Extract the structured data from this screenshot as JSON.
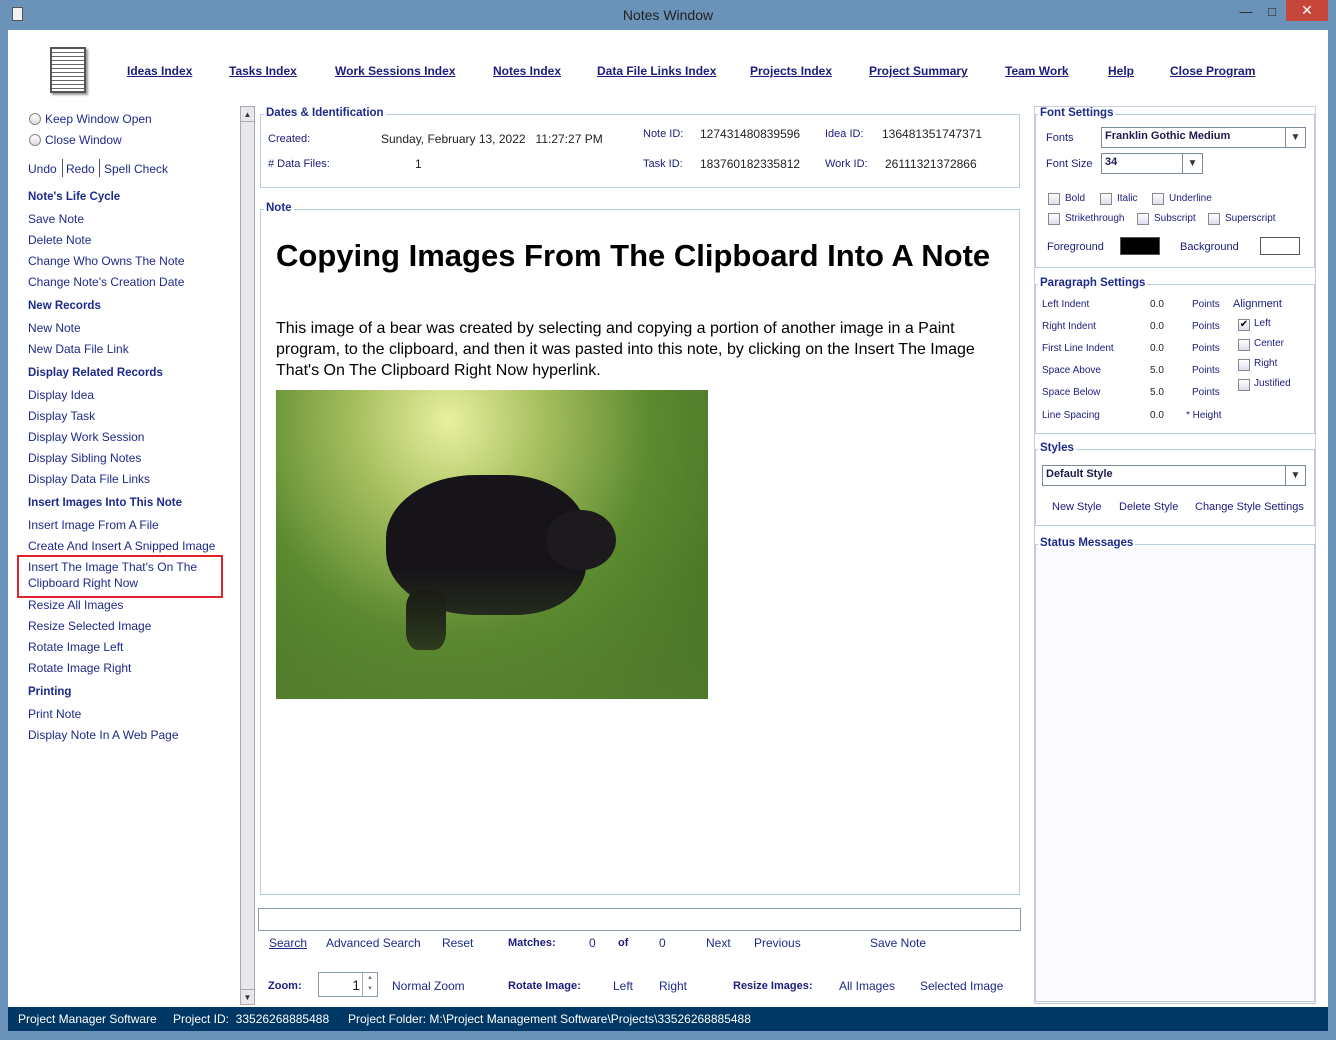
{
  "window": {
    "title": "Notes Window",
    "minimize": "—",
    "maximize": "□",
    "close": "✕"
  },
  "nav": [
    "Ideas Index",
    "Tasks Index",
    "Work Sessions Index",
    "Notes Index",
    "Data File Links Index",
    "Projects Index",
    "Project Summary",
    "Team Work",
    "Help",
    "Close Program"
  ],
  "sidebar": {
    "keep_open": "Keep Window Open",
    "close_window": "Close Window",
    "undo": "Undo",
    "redo": "Redo",
    "spell": "Spell Check",
    "sections": [
      {
        "title": "Note's Life Cycle",
        "items": [
          "Save Note",
          "Delete Note",
          "Change Who Owns The Note",
          "Change Note's Creation Date"
        ]
      },
      {
        "title": "New Records",
        "items": [
          "New Note",
          "New Data File Link"
        ]
      },
      {
        "title": "Display Related Records",
        "items": [
          "Display Idea",
          "Display Task",
          "Display Work Session",
          "Display Sibling Notes",
          "Display Data File Links"
        ]
      },
      {
        "title": "Insert Images Into This Note",
        "items": [
          "Insert Image From A File",
          "Create And Insert A Snipped Image",
          "Insert The Image That's On The Clipboard Right Now",
          "Resize All Images",
          "Resize Selected Image",
          "Rotate Image Left",
          "Rotate Image Right"
        ]
      },
      {
        "title": "Printing",
        "items": [
          "Print Note",
          "Display Note In A Web Page"
        ]
      }
    ],
    "highlight_color": "#e0202a"
  },
  "ids": {
    "title": "Dates & Identification",
    "created_label": "Created:",
    "created": "Sunday, February 13, 2022   11:27:27 PM",
    "files_label": "# Data Files:",
    "files": "1",
    "note_id_label": "Note ID:",
    "note_id": "127431480839596",
    "task_id_label": "Task ID:",
    "task_id": "183760182335812",
    "idea_id_label": "Idea ID:",
    "idea_id": "136481351747371",
    "work_id_label": "Work ID:",
    "work_id": "26111321372866"
  },
  "note": {
    "label": "Note",
    "heading": "Copying Images From The Clipboard Into A Note",
    "body": "This image of a bear was created by selecting and copying a portion of another image in a Paint program, to the clipboard, and then it was pasted into this note, by clicking on the Insert The Image That's On The Clipboard Right Now hyperlink."
  },
  "search": {
    "value": "",
    "search": "Search",
    "advanced": "Advanced Search",
    "reset": "Reset",
    "matches_label": "Matches:",
    "matches": "0",
    "of": "of",
    "total": "0",
    "next": "Next",
    "previous": "Previous",
    "save": "Save Note"
  },
  "bottom": {
    "zoom_label": "Zoom:",
    "zoom": "1",
    "normal_zoom": "Normal Zoom",
    "rotate_label": "Rotate Image:",
    "left": "Left",
    "right": "Right",
    "resize_label": "Resize Images:",
    "all": "All Images",
    "selected": "Selected Image"
  },
  "font": {
    "title": "Font Settings",
    "fonts_label": "Fonts",
    "font": "Franklin Gothic Medium",
    "size_label": "Font Size",
    "size": "34",
    "bold": "Bold",
    "italic": "Italic",
    "underline": "Underline",
    "strike": "Strikethrough",
    "sub": "Subscript",
    "sup": "Superscript",
    "fg_label": "Foreground",
    "fg": "#000000",
    "bg_label": "Background",
    "bg": "#ffffff"
  },
  "para": {
    "title": "Paragraph Settings",
    "rows": [
      {
        "l": "Left Indent",
        "v": "0.0",
        "u": "Points"
      },
      {
        "l": "Right Indent",
        "v": "0.0",
        "u": "Points"
      },
      {
        "l": "First Line Indent",
        "v": "0.0",
        "u": "Points"
      },
      {
        "l": "Space Above",
        "v": "5.0",
        "u": "Points"
      },
      {
        "l": "Space Below",
        "v": "5.0",
        "u": "Points"
      },
      {
        "l": "Line Spacing",
        "v": "0.0",
        "u": "* Height"
      }
    ],
    "align_label": "Alignment",
    "align": [
      "Left",
      "Center",
      "Right",
      "Justified"
    ],
    "align_checked": "Left"
  },
  "styles": {
    "title": "Styles",
    "current": "Default Style",
    "new": "New Style",
    "delete": "Delete Style",
    "change": "Change Style Settings"
  },
  "status_messages": {
    "title": "Status Messages"
  },
  "statusbar": {
    "app": "Project Manager Software",
    "project_id": "Project ID:  33526268885488",
    "folder": "Project Folder: M:\\Project Management Software\\Projects\\33526268885488"
  }
}
